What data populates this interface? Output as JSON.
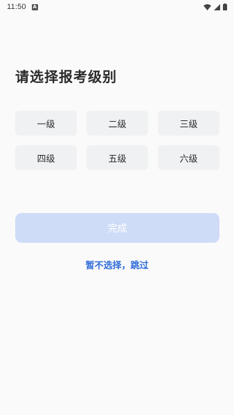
{
  "status_bar": {
    "time": "11:50",
    "app_icon_letter": "A"
  },
  "page": {
    "title": "请选择报考级别",
    "levels": [
      "一级",
      "二级",
      "三级",
      "四级",
      "五级",
      "六级"
    ],
    "done_label": "完成",
    "skip_label": "暂不选择，跳过"
  },
  "colors": {
    "background": "#fafafa",
    "level_button_bg": "#f0f1f3",
    "done_button_bg": "#cfdcf7",
    "accent": "#2f6bd8"
  }
}
